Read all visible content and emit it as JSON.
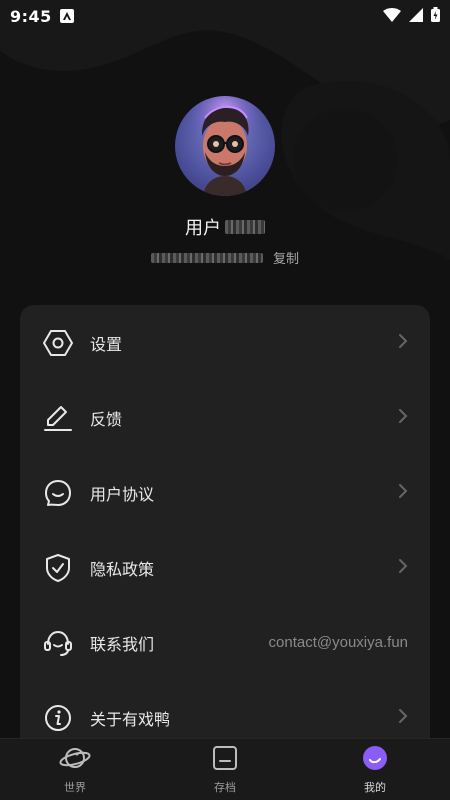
{
  "status_bar": {
    "time": "9:45",
    "icons": [
      "app-notification-icon",
      "wifi-icon",
      "signal-icon",
      "battery-icon"
    ]
  },
  "profile": {
    "username_prefix": "用户",
    "copy_label": "复制"
  },
  "menu": {
    "items": [
      {
        "label": "设置",
        "icon": "hexagon-settings-icon",
        "chevron": true
      },
      {
        "label": "反馈",
        "icon": "pen-icon",
        "chevron": true
      },
      {
        "label": "用户协议",
        "icon": "chat-bubble-icon",
        "chevron": true
      },
      {
        "label": "隐私政策",
        "icon": "shield-check-icon",
        "chevron": true
      },
      {
        "label": "联系我们",
        "icon": "headset-icon",
        "value": "contact@youxiya.fun"
      },
      {
        "label": "关于有戏鸭",
        "icon": "info-icon",
        "chevron": true
      }
    ]
  },
  "bottom_nav": {
    "items": [
      {
        "label": "世界",
        "icon": "planet-icon"
      },
      {
        "label": "存档",
        "icon": "archive-icon"
      },
      {
        "label": "我的",
        "icon": "profile-moon-icon",
        "active": true
      }
    ],
    "accent_color": "#8b5cf6"
  }
}
